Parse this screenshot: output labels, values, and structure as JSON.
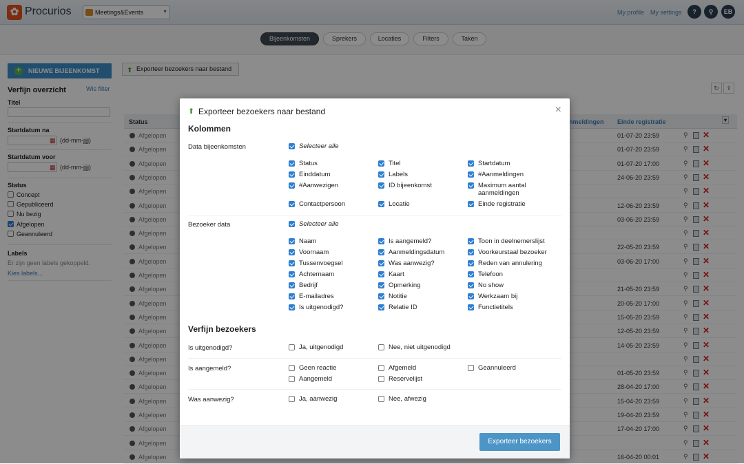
{
  "header": {
    "brand": "Procurios",
    "app": "Meetings&Events",
    "my_profile": "My profile",
    "my_settings": "My settings",
    "help": "?",
    "avatar": "EB",
    "icons": [
      "help-icon",
      "search-icon"
    ]
  },
  "tabs": [
    "Bijeenkomsten",
    "Sprekers",
    "Locaties",
    "Filters",
    "Taken"
  ],
  "sidebar": {
    "new_button": "NIEUWE BIJEENKOMST",
    "refine_title": "Verfijn overzicht",
    "clear_filter": "Wis filter",
    "title_label": "Titel",
    "start_after_label": "Startdatum na",
    "start_before_label": "Startdatum voor",
    "date_hint": "(dd-mm-jjjj)",
    "status_label": "Status",
    "statuses": [
      {
        "label": "Concept",
        "checked": false
      },
      {
        "label": "Gepubliceerd",
        "checked": false
      },
      {
        "label": "Nu bezig",
        "checked": false
      },
      {
        "label": "Afgelopen",
        "checked": true
      },
      {
        "label": "Geannuleerd",
        "checked": false
      }
    ],
    "labels_label": "Labels",
    "no_labels": "Er zijn geen labels gekoppeld.",
    "choose_labels": "Kies labels..."
  },
  "toolbar": {
    "export": "Exporteer bezoekers naar bestand"
  },
  "table": {
    "headers": {
      "status": "Status",
      "registrations": "nmeldingen",
      "end_registration": "Einde registratie"
    },
    "rows": [
      {
        "status": "Afgelopen",
        "end": "01-07-20 23:59"
      },
      {
        "status": "Afgelopen",
        "end": "01-07-20 23:59"
      },
      {
        "status": "Afgelopen",
        "end": "01-07-20 17:00"
      },
      {
        "status": "Afgelopen",
        "end": "24-06-20 23:59"
      },
      {
        "status": "Afgelopen",
        "end": ""
      },
      {
        "status": "Afgelopen",
        "end": "12-06-20 23:59"
      },
      {
        "status": "Afgelopen",
        "end": "03-06-20 23:59"
      },
      {
        "status": "Afgelopen",
        "end": ""
      },
      {
        "status": "Afgelopen",
        "end": "22-05-20 23:59"
      },
      {
        "status": "Afgelopen",
        "end": "03-06-20 17:00"
      },
      {
        "status": "Afgelopen",
        "end": ""
      },
      {
        "status": "Afgelopen",
        "end": "21-05-20 23:59"
      },
      {
        "status": "Afgelopen",
        "end": "20-05-20 17:00"
      },
      {
        "status": "Afgelopen",
        "end": "15-05-20 23:59"
      },
      {
        "status": "Afgelopen",
        "end": "12-05-20 23:59"
      },
      {
        "status": "Afgelopen",
        "end": "14-05-20 23:59"
      },
      {
        "status": "Afgelopen",
        "end": ""
      },
      {
        "status": "Afgelopen",
        "end": "01-05-20 23:59"
      },
      {
        "status": "Afgelopen",
        "end": "28-04-20 17:00"
      },
      {
        "status": "Afgelopen",
        "end": "15-04-20 23:59"
      },
      {
        "status": "Afgelopen",
        "end": "19-04-20 23:59"
      },
      {
        "status": "Afgelopen",
        "end": "17-04-20 17:00"
      },
      {
        "status": "Afgelopen",
        "end": ""
      },
      {
        "status": "Afgelopen",
        "end": "16-04-20 00:01"
      }
    ]
  },
  "modal": {
    "title": "Exporteer bezoekers naar bestand",
    "close": "×",
    "columns_heading": "Kolommen",
    "event_data": {
      "label": "Data bijeenkomsten",
      "select_all": "Selecteer alle",
      "options": [
        "Status",
        "Titel",
        "Startdatum",
        "Einddatum",
        "Labels",
        "#Aanmeldingen",
        "#Aanwezigen",
        "ID bijeenkomst",
        "Maximum aantal aanmeldingen",
        "Contactpersoon",
        "Locatie",
        "Einde registratie"
      ]
    },
    "visitor_data": {
      "label": "Bezoeker data",
      "select_all": "Selecteer alle",
      "options": [
        "Naam",
        "Is aangemeld?",
        "Toon in deelnemerslijst",
        "Voornaam",
        "Aanmeldingsdatum",
        "Voorkeurstaal bezoeker",
        "Tussenvoegsel",
        "Was aanwezig?",
        "Reden van annulering",
        "Achternaam",
        "Kaart",
        "Telefoon",
        "Bedrijf",
        "Opmerking",
        "No show",
        "E-mailadres",
        "Notitie",
        "Werkzaam bij",
        "Is uitgenodigd?",
        "Relatie ID",
        "Functietitels"
      ]
    },
    "refine_heading": "Verfijn bezoekers",
    "invited": {
      "label": "Is uitgenodigd?",
      "options": [
        "Ja, uitgenodigd",
        "Nee, niet uitgenodigd"
      ]
    },
    "registered": {
      "label": "Is aangemeld?",
      "options": [
        "Geen reactie",
        "Afgemeld",
        "Geannuleerd",
        "Aangemeld",
        "Reservelijst"
      ]
    },
    "present": {
      "label": "Was aanwezig?",
      "options": [
        "Ja, aanwezig",
        "Nee, afwezig"
      ]
    },
    "submit": "Exporteer bezoekers"
  }
}
